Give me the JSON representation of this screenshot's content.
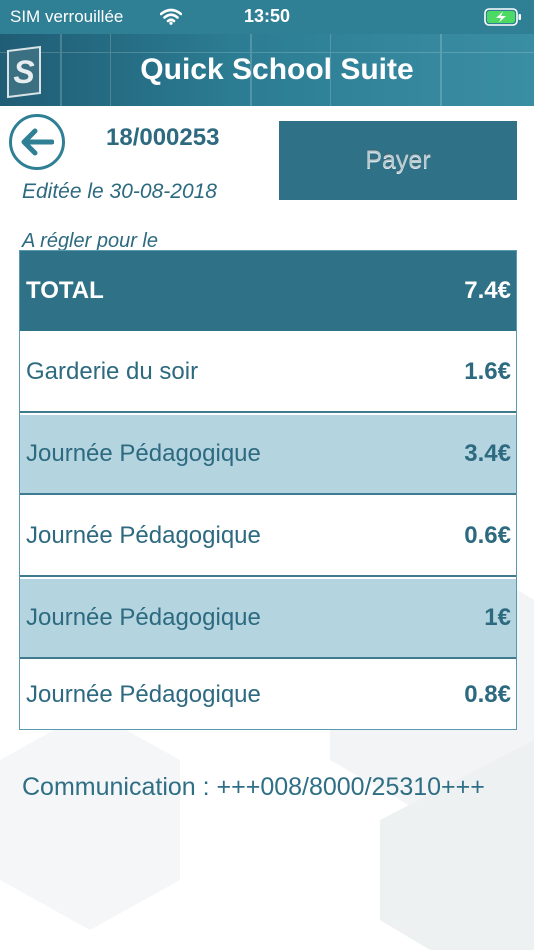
{
  "status_bar": {
    "carrier": "SIM verrouillée",
    "time": "13:50"
  },
  "header": {
    "title": "Quick School Suite"
  },
  "invoice": {
    "number": "18/000253",
    "edited": "Editée le 30-08-2018",
    "due_label": "A régler pour le",
    "pay_label": "Payer"
  },
  "table": {
    "total": {
      "label": "TOTAL",
      "amount": "7.4€"
    },
    "items": [
      {
        "label": "Garderie du soir",
        "amount": "1.6€"
      },
      {
        "label": "Journée Pédagogique",
        "amount": "3.4€"
      },
      {
        "label": "Journée Pédagogique",
        "amount": "0.6€"
      },
      {
        "label": "Journée Pédagogique",
        "amount": "1€"
      },
      {
        "label": "Journée Pédagogique",
        "amount": "0.8€"
      }
    ]
  },
  "communication": "Communication : +++008/8000/25310+++",
  "colors": {
    "accent": "#2f7287",
    "shaded_row": "#b4d5e0",
    "battery": "#4cd964"
  }
}
